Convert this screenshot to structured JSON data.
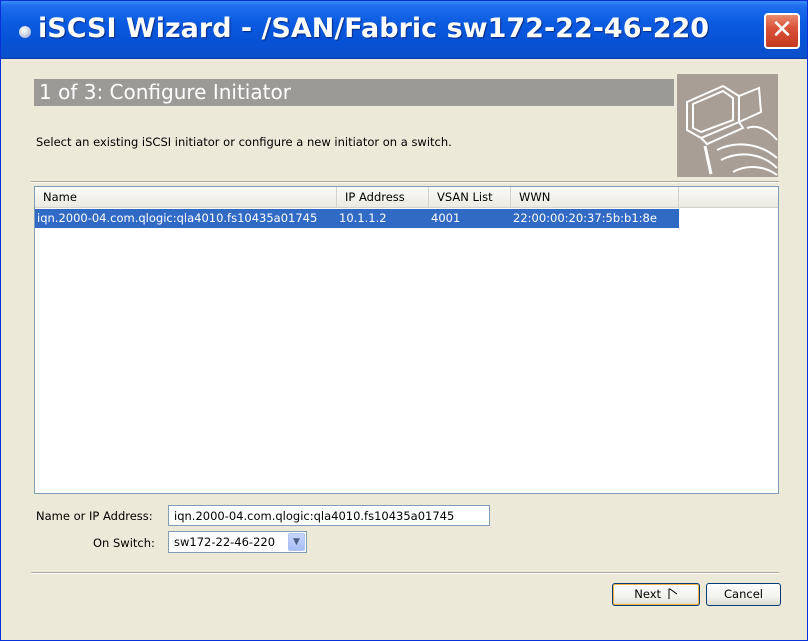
{
  "window": {
    "title": "iSCSI Wizard - /SAN/Fabric sw172-22-46-220",
    "close_label": "✕"
  },
  "header": {
    "step_title": "1 of 3: Configure Initiator",
    "instruction": "Select an existing iSCSI initiator or configure a new initiator on a switch."
  },
  "table": {
    "columns": [
      "Name",
      "IP Address",
      "VSAN List",
      "WWN"
    ],
    "rows": [
      {
        "name": "iqn.2000-04.com.qlogic:qla4010.fs10435a01745",
        "ip": "10.1.1.2",
        "vsan": "4001",
        "wwn": "22:00:00:20:37:5b:b1:8e",
        "selected": true
      }
    ]
  },
  "form": {
    "name_label": "Name or IP Address:",
    "name_value": "iqn.2000-04.com.qlogic:qla4010.fs10435a01745",
    "switch_label": "On Switch:",
    "switch_value": "sw172-22-46-220"
  },
  "buttons": {
    "next": "Next",
    "cancel": "Cancel"
  },
  "colors": {
    "titlebar": "#0a5ae0",
    "selection": "#316ac5",
    "header_band": "#9c9a97"
  }
}
